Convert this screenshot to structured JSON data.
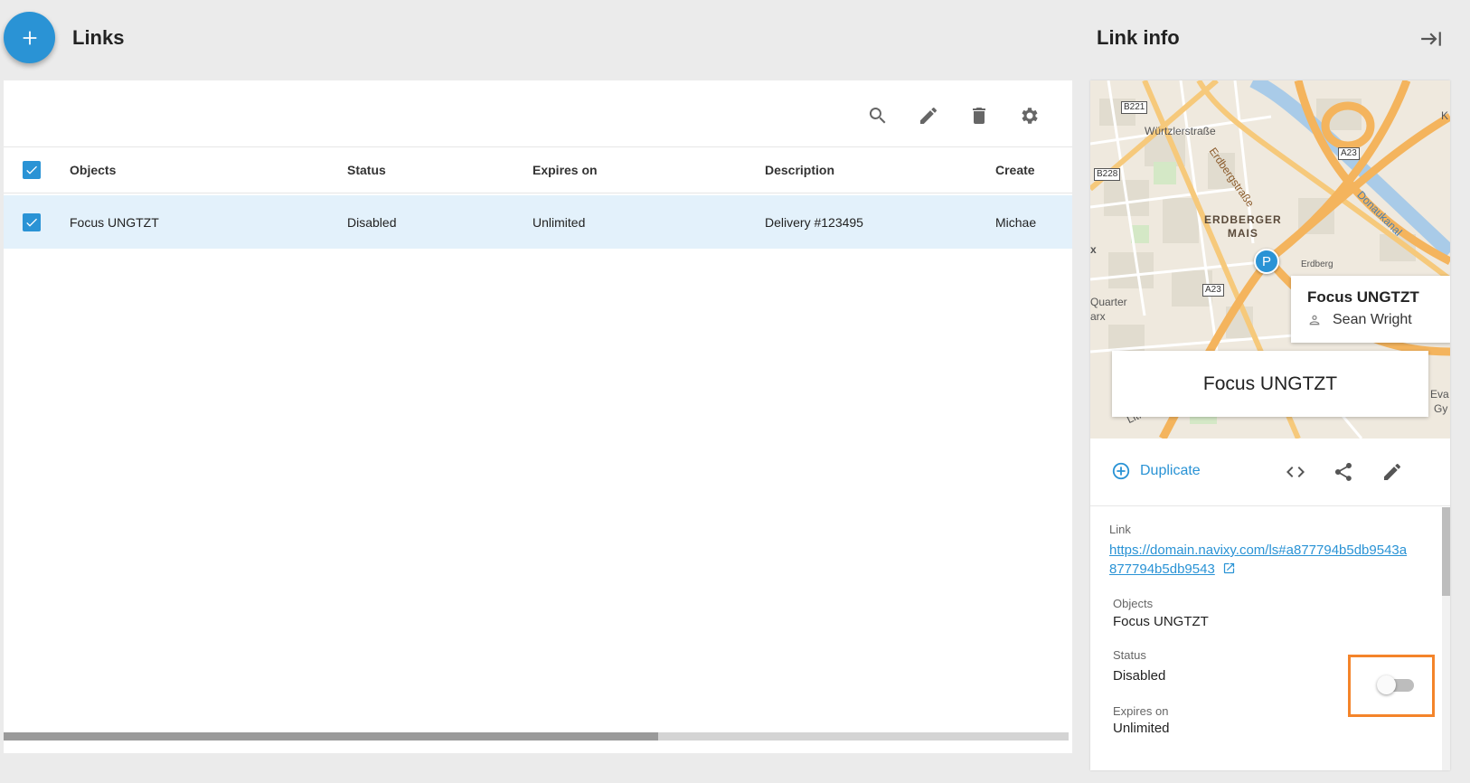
{
  "header": {
    "title": "Links",
    "add_icon": "plus-icon"
  },
  "toolbar": {
    "icons": [
      "search-icon",
      "edit-icon",
      "delete-icon",
      "settings-icon"
    ]
  },
  "table": {
    "columns": [
      "Objects",
      "Status",
      "Expires on",
      "Description",
      "Create"
    ],
    "rows": [
      {
        "selected": true,
        "objects": "Focus UNGTZT",
        "status": "Disabled",
        "expires": "Unlimited",
        "description": "Delivery #123495",
        "created": "Michae"
      }
    ]
  },
  "info": {
    "title": "Link info",
    "collapse_icon": "collapse-right-icon",
    "map": {
      "labels": {
        "b221": "B221",
        "b228": "B228",
        "a23a": "A23",
        "a23b": "A23",
        "wurtzler": "Würtzlerstraße",
        "erdberg": "Erdbergstraße",
        "district1": "ERDBERGER",
        "district2": "MAIS",
        "quarter": "Quarter",
        "arx": "arx",
        "donau": "Donaukanal",
        "erdberg_short": "Erdberg",
        "k": "K",
        "x": "x",
        "eva": "Eva",
        "gy": "Gy",
        "litfa": "Litfa"
      },
      "marker": "P",
      "popup_title": "Focus UNGTZT",
      "popup_user": "Sean Wright"
    },
    "name_card": "Focus UNGTZT",
    "duplicate_label": "Duplicate",
    "link_label": "Link",
    "link_url": "https://domain.navixy.com/ls#a877794b5db9543a877794b5db9543",
    "objects_label": "Objects",
    "objects_value": "Focus UNGTZT",
    "status_label": "Status",
    "status_value": "Disabled",
    "status_enabled": false,
    "expires_label": "Expires on",
    "expires_value": "Unlimited",
    "accent_color": "#2a93d5",
    "highlight_color": "#f4842a"
  }
}
